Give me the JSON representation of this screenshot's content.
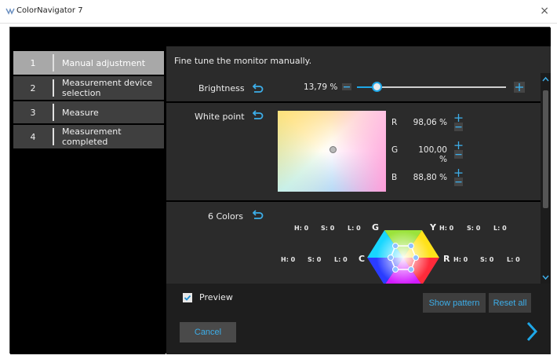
{
  "window": {
    "title": "ColorNavigator 7",
    "close_label": "×",
    "icons": {
      "app": "colornavigator-app-icon",
      "close": "close-icon"
    }
  },
  "steps": [
    {
      "number": "1",
      "label": "Manual adjustment",
      "active": true
    },
    {
      "number": "2",
      "label": "Measurement device selection",
      "active": false
    },
    {
      "number": "3",
      "label": "Measure",
      "active": false
    },
    {
      "number": "4",
      "label": "Measurement completed",
      "active": false
    }
  ],
  "main": {
    "instruction": "Fine tune the monitor manually."
  },
  "brightness": {
    "label": "Brightness",
    "value": "13,79 %",
    "slider_fraction": 0.13
  },
  "white_point": {
    "label": "White point",
    "channels": [
      {
        "letter": "R",
        "value": "98,06 %"
      },
      {
        "letter": "G",
        "value": "100,00 %"
      },
      {
        "letter": "B",
        "value": "88,80 %"
      }
    ]
  },
  "six_colors": {
    "label": "6 Colors",
    "axes": {
      "g": "G",
      "y": "Y",
      "c": "C",
      "r": "R"
    },
    "hsl_top_left": {
      "h": "H: 0",
      "s": "S: 0",
      "l": "L: 0"
    },
    "hsl_top_right": {
      "h": "H: 0",
      "s": "S: 0",
      "l": "L: 0"
    },
    "hsl_mid_left": {
      "h": "H: 0",
      "s": "S: 0",
      "l": "L: 0"
    },
    "hsl_mid_right": {
      "h": "H: 0",
      "s": "S: 0",
      "l": "L: 0"
    }
  },
  "footer": {
    "preview_label": "Preview",
    "preview_checked": true,
    "show_pattern_label": "Show pattern",
    "reset_all_label": "Reset all",
    "cancel_label": "Cancel"
  },
  "colors": {
    "accent": "#3daee9",
    "panel": "#2b2b2b",
    "active_step": "#a8a8a8"
  }
}
